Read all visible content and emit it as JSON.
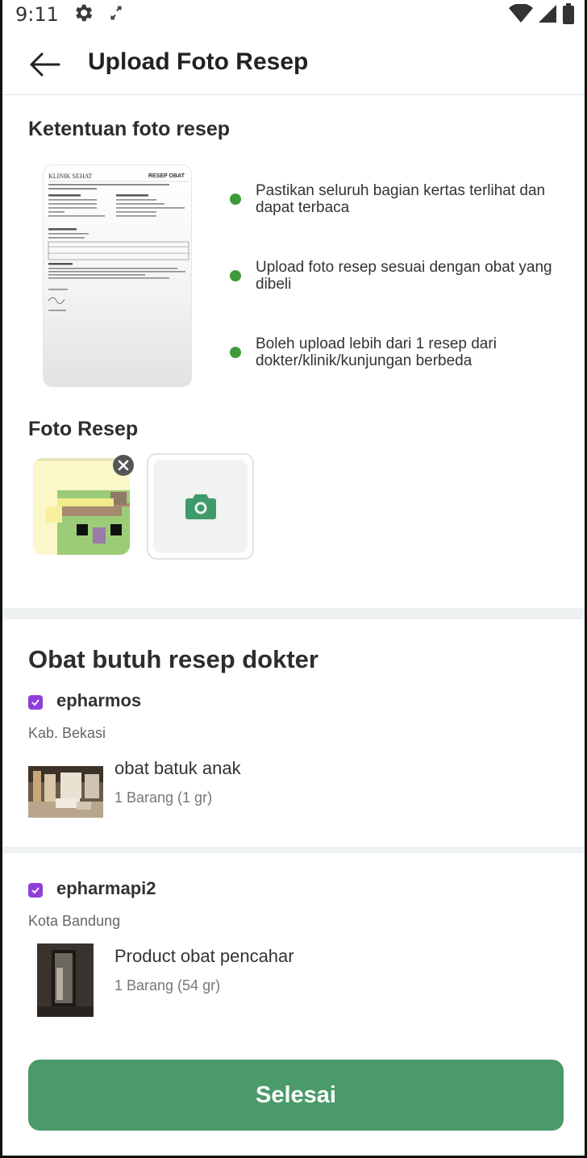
{
  "status_bar": {
    "time": "9:11",
    "icons": [
      "gear-icon",
      "rotate-icon",
      "wifi-icon",
      "signal-icon",
      "battery-icon"
    ]
  },
  "header": {
    "back_icon": "arrow-left-icon",
    "title": "Upload Foto Resep"
  },
  "requirements": {
    "title": "Ketentuan foto resep",
    "example_image": {
      "clinic": "KLINIK SEHAT",
      "doc_title": "RESEP OBAT"
    },
    "items": [
      "Pastikan seluruh bagian kertas terlihat dan dapat terbaca",
      "Upload foto resep sesuai dengan obat yang dibeli",
      "Boleh upload lebih dari 1 resep dari dokter/klinik/kunjungan berbeda"
    ],
    "bullet_color": "#3f9a3a"
  },
  "photos": {
    "title": "Foto Resep",
    "remove_icon": "close-circle-icon",
    "add_icon": "camera-icon",
    "accent": "#3f9a6a"
  },
  "prescription_drugs": {
    "title": "Obat butuh resep dokter",
    "stores": [
      {
        "name": "epharmos",
        "city": "Kab. Bekasi",
        "badge_icon": "verified-badge-icon",
        "product": {
          "name": "obat batuk anak",
          "qty": "1 Barang (1 gr)"
        }
      },
      {
        "name": "epharmapi2",
        "city": "Kota Bandung",
        "badge_icon": "verified-badge-icon",
        "product": {
          "name": "Product obat pencahar",
          "qty": "1 Barang (54 gr)"
        }
      }
    ]
  },
  "footer": {
    "done_label": "Selesai",
    "button_color": "#4a9a6a"
  }
}
